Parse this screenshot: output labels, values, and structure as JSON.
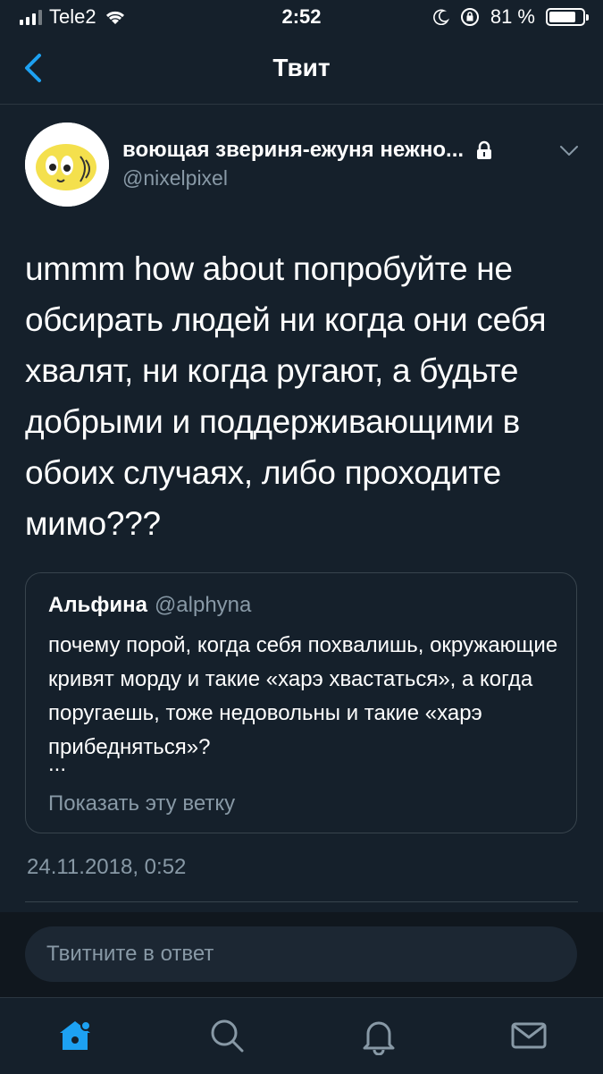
{
  "status_bar": {
    "carrier": "Tele2",
    "time": "2:52",
    "battery_percent": "81 %",
    "battery_level": 0.81
  },
  "nav": {
    "title": "Твит"
  },
  "tweet": {
    "author_name": "воющая звериня-ежуня нежно...",
    "author_handle": "@nixelpixel",
    "text": "ummm how about попробуйте не обсирать людей ни когда они себя хвалят, ни когда ругают, а будьте добрыми и поддерживающими в обоих случаях, либо проходите мимо???",
    "timestamp": "24.11.2018, 0:52"
  },
  "quoted_tweet": {
    "author_name": "Альфина",
    "author_handle": "@alphyna",
    "text": "почему порой, когда себя похвалишь, окружающие кривят морду и такие «харэ хвастаться», а когда поругаешь, тоже недовольны и такие «харэ прибедняться»?",
    "ellipsis": "...",
    "show_thread": "Показать эту ветку"
  },
  "reply": {
    "placeholder": "Твитните в ответ"
  },
  "tabs": [
    {
      "icon": "home-icon",
      "active": true
    },
    {
      "icon": "search-icon",
      "active": false
    },
    {
      "icon": "bell-icon",
      "active": false
    },
    {
      "icon": "mail-icon",
      "active": false
    }
  ],
  "colors": {
    "background": "#15202b",
    "accent": "#1da1f2",
    "secondary_text": "#8899a6",
    "border": "#38444d"
  }
}
